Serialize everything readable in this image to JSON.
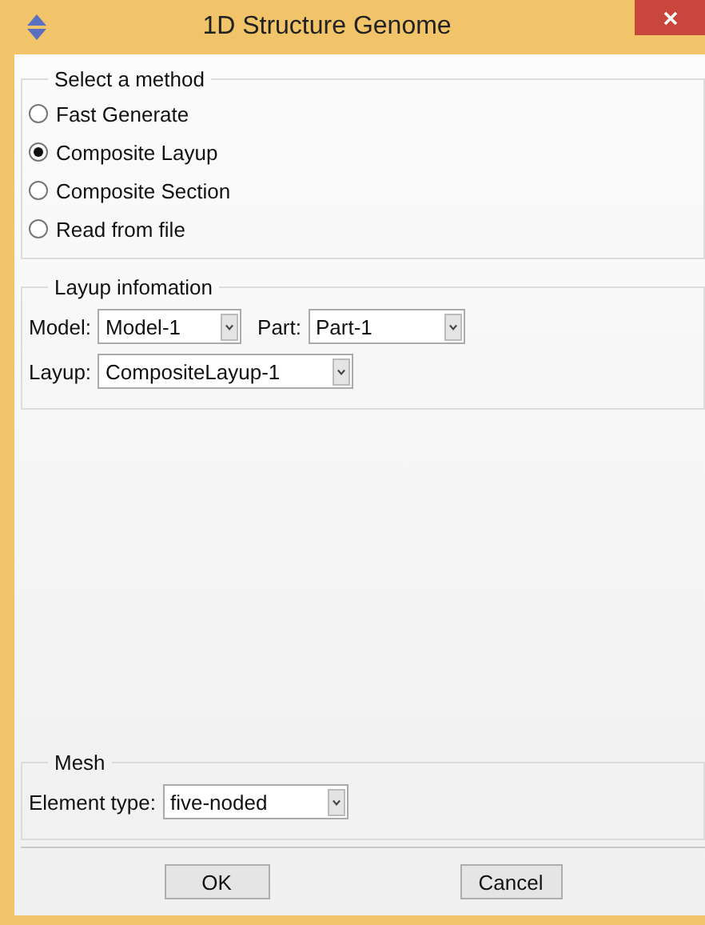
{
  "window": {
    "title": "1D Structure Genome"
  },
  "method_group": {
    "title": "Select a method",
    "options": [
      {
        "label": "Fast Generate",
        "selected": false
      },
      {
        "label": "Composite Layup",
        "selected": true
      },
      {
        "label": "Composite Section",
        "selected": false
      },
      {
        "label": "Read from file",
        "selected": false
      }
    ]
  },
  "layup_group": {
    "title": "Layup infomation",
    "rows": [
      [
        {
          "label": "Model:",
          "value": "Model-1"
        },
        {
          "label": "Part:",
          "value": "Part-1"
        }
      ],
      [
        {
          "label": "Layup:",
          "value": "CompositeLayup-1"
        }
      ]
    ]
  },
  "mesh_group": {
    "title": "Mesh",
    "fields": [
      {
        "label": "Element type:",
        "value": "five-noded"
      }
    ]
  },
  "buttons": [
    "OK",
    "Cancel"
  ]
}
